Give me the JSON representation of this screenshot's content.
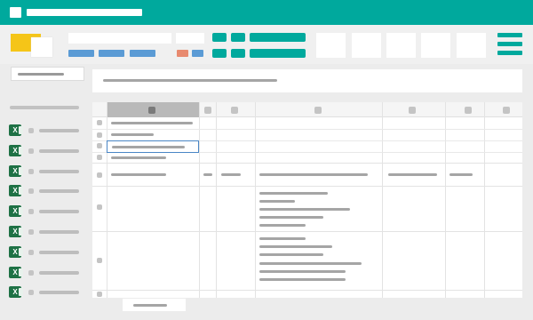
{
  "app": {
    "title_bar_color": "#00a99d",
    "accent_logo_color": "#f5c518"
  },
  "icons": {
    "window": "window-icon",
    "hamburger": "hamburger-menu-icon",
    "excel": "excel-file-icon"
  },
  "toolbar": {
    "blue_buttons": 3,
    "orange_button_color": "#e88a6f",
    "blue_button_color": "#5b9bd5"
  },
  "sidebar": {
    "file_count": 9
  },
  "sheet": {
    "header_columns": 7
  }
}
